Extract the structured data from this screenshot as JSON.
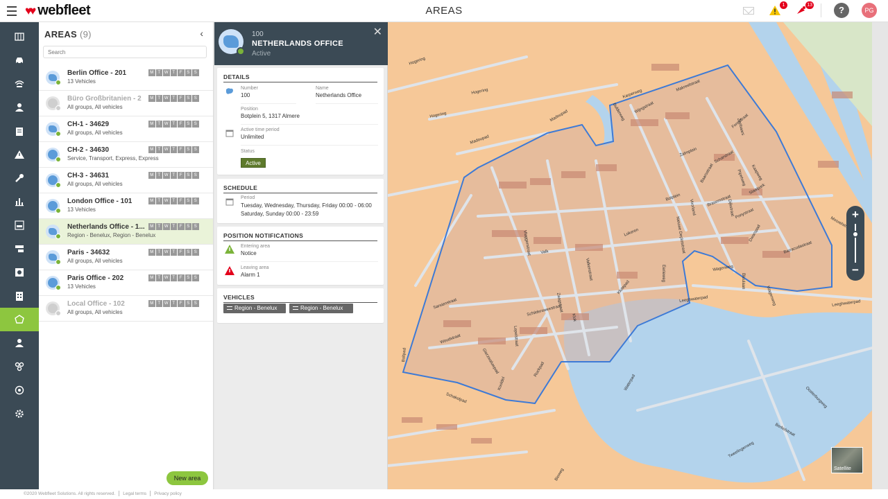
{
  "app": {
    "logo_text": "webfleet",
    "page_title": "AREAS"
  },
  "top_icons": {
    "alert_badge": "1",
    "message_badge": "13",
    "help_label": "?",
    "avatar_initials": "PG"
  },
  "rail": [
    "map-icon",
    "car-icon",
    "signal-icon",
    "driver-icon",
    "clipboard-icon",
    "warning-icon",
    "wrench-icon",
    "chart-icon",
    "pdf-icon",
    "route-icon",
    "camera-icon",
    "building-icon",
    "area-icon",
    "user-icon",
    "link-icon",
    "gauge-icon",
    "gear-icon"
  ],
  "areas": {
    "header": "AREAS",
    "count": "(9)",
    "collapse": "‹",
    "search_placeholder": "Search",
    "day_letters": [
      "M",
      "T",
      "W",
      "T",
      "F",
      "S",
      "S"
    ],
    "items": [
      {
        "name": "Berlin Office - 201",
        "sub": "13 Vehicles",
        "active": true,
        "shape": "region"
      },
      {
        "name": "Büro Großbritanien - 2",
        "sub": "All groups, All vehicles",
        "active": false,
        "shape": "circle"
      },
      {
        "name": "CH-1 - 34629",
        "sub": "All groups, All vehicles",
        "active": true,
        "shape": "region"
      },
      {
        "name": "CH-2 - 34630",
        "sub": "Service, Transport, Express, Express",
        "active": true,
        "shape": "circle"
      },
      {
        "name": "CH-3 - 34631",
        "sub": "All groups, All vehicles",
        "active": true,
        "shape": "circle"
      },
      {
        "name": "London Office - 101",
        "sub": "13 Vehicles",
        "active": true,
        "shape": "circle"
      },
      {
        "name": "Netherlands Office - 1...",
        "sub": "Region - Benelux, Region - Benelux",
        "active": true,
        "shape": "region",
        "selected": true
      },
      {
        "name": "Paris - 34632",
        "sub": "All groups, All vehicles",
        "active": true,
        "shape": "region"
      },
      {
        "name": "Paris Office - 202",
        "sub": "13 Vehicles",
        "active": true,
        "shape": "circle"
      },
      {
        "name": "Local Office - 102",
        "sub": "All groups, All vehicles",
        "active": false,
        "shape": "circle"
      }
    ],
    "new_area_label": "New area"
  },
  "detail": {
    "number": "100",
    "title": "NETHERLANDS OFFICE",
    "status": "Active",
    "close": "✕",
    "details": {
      "title": "DETAILS",
      "number_label": "Number",
      "number_value": "100",
      "name_label": "Name",
      "name_value": "Netherlands Office",
      "position_label": "Position",
      "position_value": "Botplein 5, 1317 Almere",
      "period_label": "Active time period",
      "period_value": "Unlimited",
      "status_label": "Status",
      "status_value": "Active"
    },
    "schedule": {
      "title": "SCHEDULE",
      "period_label": "Period",
      "line1": "Tuesday, Wednesday, Thursday, Friday 00:00 - 06:00",
      "line2": "Saturday, Sunday 00:00 - 23:59"
    },
    "notifications": {
      "title": "POSITION NOTIFICATIONS",
      "entering_label": "Entering area",
      "entering_value": "Notice",
      "leaving_label": "Leaving area",
      "leaving_value": "Alarm 1"
    },
    "vehicles": {
      "title": "VEHICLES",
      "items": [
        "Region - Benelux",
        "Region - Benelux"
      ]
    }
  },
  "map": {
    "streets": [
      "Hogering",
      "Hogering",
      "Hogering",
      "Madoupad",
      "Madoupad",
      "Karperweg",
      "Makreelstraat",
      "Bulderweg",
      "Wijngstraat",
      "Forelstraat",
      "Zeebaars",
      "Scharstraat",
      "Zalmplein",
      "Baarsstraat",
      "Botplein",
      "Voorland",
      "Brasemstraat",
      "Ponystraat",
      "Staaipark",
      "Valk",
      "Nieuwe Deplotstraat",
      "Lokeren",
      "Schildersweestraat",
      "Sarsienstraat",
      "Woudstraat",
      "Eerieweg",
      "Leeghwaterpad",
      "Leeghwaterpad",
      "Schakelpad",
      "Berkelstraat",
      "Waterpad",
      "Bioweg",
      "Kaapweg",
      "Wagenweg",
      "Bleulaan",
      "Mosselstraat",
      "Barracudastraat",
      "Dwarspad",
      "Dijkstraat",
      "Pipetweg",
      "Wagenweg",
      "Klok",
      "Vlaggenstraat",
      "Klutepad",
      "Valkenstraat",
      "Zaagstraat",
      "Rockpad",
      "Kooldel",
      "Gierzwaluwpad",
      "Lepelstraat",
      "Oosterburgweg",
      "Tweelingenweg",
      "Boltpad"
    ],
    "zoom_in": "+",
    "zoom_out": "−",
    "satellite_label": "Satellite"
  },
  "footer": {
    "copyright": "©2020 Webfleet Solutions. All rights reserved.",
    "legal": "Legal terms",
    "privacy": "Privacy policy"
  },
  "colors": {
    "accent": "#8dc63f",
    "rail": "#3b4a55",
    "map_land": "#f6c898",
    "map_water": "#b3d3ec",
    "area_outline": "#3d7ad6"
  }
}
